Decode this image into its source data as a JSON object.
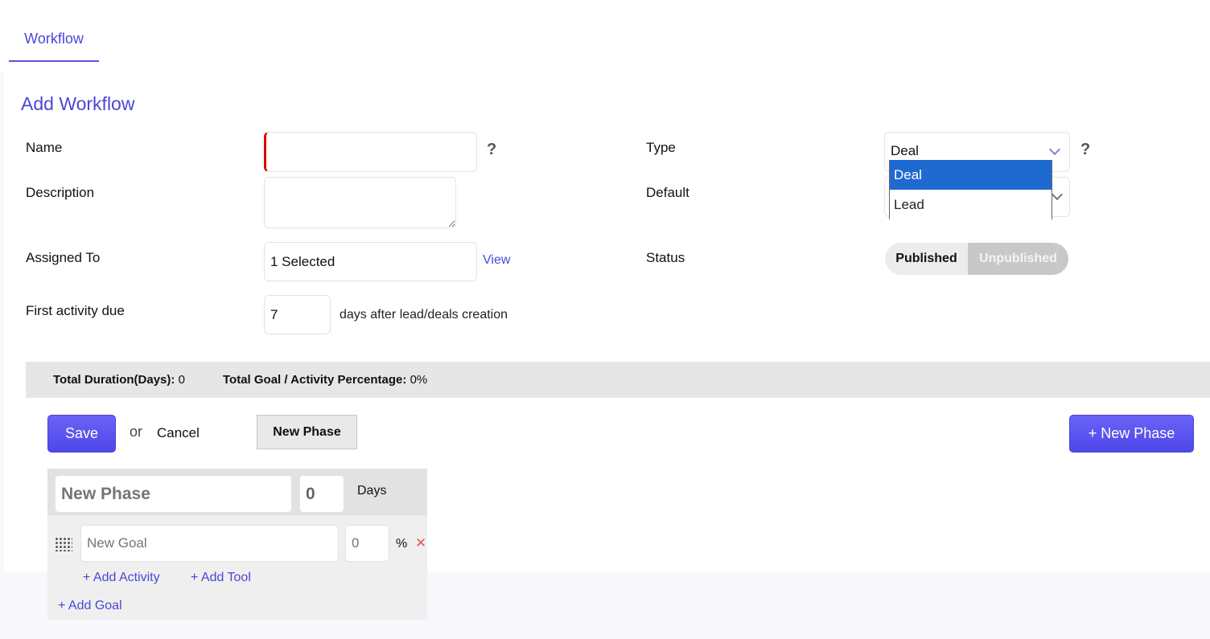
{
  "tabs": [
    {
      "label": "Workflow",
      "active": true
    }
  ],
  "page_title": "Add Workflow",
  "form": {
    "name": {
      "label": "Name",
      "value": "",
      "help": "?"
    },
    "description": {
      "label": "Description",
      "value": ""
    },
    "assigned_to": {
      "label": "Assigned To",
      "value": "1 Selected",
      "view_link": "View"
    },
    "first_activity": {
      "label": "First activity due",
      "value": "7",
      "suffix": "days after lead/deals creation"
    },
    "type": {
      "label": "Type",
      "value": "Deal",
      "help": "?",
      "options": [
        "Deal",
        "Lead"
      ],
      "selected": "Deal"
    },
    "default": {
      "label": "Default"
    },
    "status": {
      "label": "Status",
      "options": [
        "Published",
        "Unpublished"
      ],
      "active": "Published"
    }
  },
  "summary": {
    "duration_label": "Total Duration(Days):",
    "duration_value": "0",
    "goal_label": "Total Goal / Activity Percentage:",
    "goal_value": "0%"
  },
  "actions": {
    "save": "Save",
    "or": "or",
    "cancel": "Cancel",
    "new_phase": "New Phase",
    "add_phase": "+ New Phase"
  },
  "phase": {
    "name_placeholder": "New Phase",
    "days_value": "0",
    "days_label": "Days",
    "goal": {
      "name_placeholder": "New Goal",
      "pct_placeholder": "0",
      "pct_symbol": "%",
      "remove": "✕"
    },
    "add_activity": "+ Add Activity",
    "add_tool": "+ Add Tool",
    "add_goal": "+ Add Goal"
  },
  "colors": {
    "accent": "#4b47d6",
    "required": "#dd0000",
    "dropdown_selected": "#1f6ad0"
  }
}
